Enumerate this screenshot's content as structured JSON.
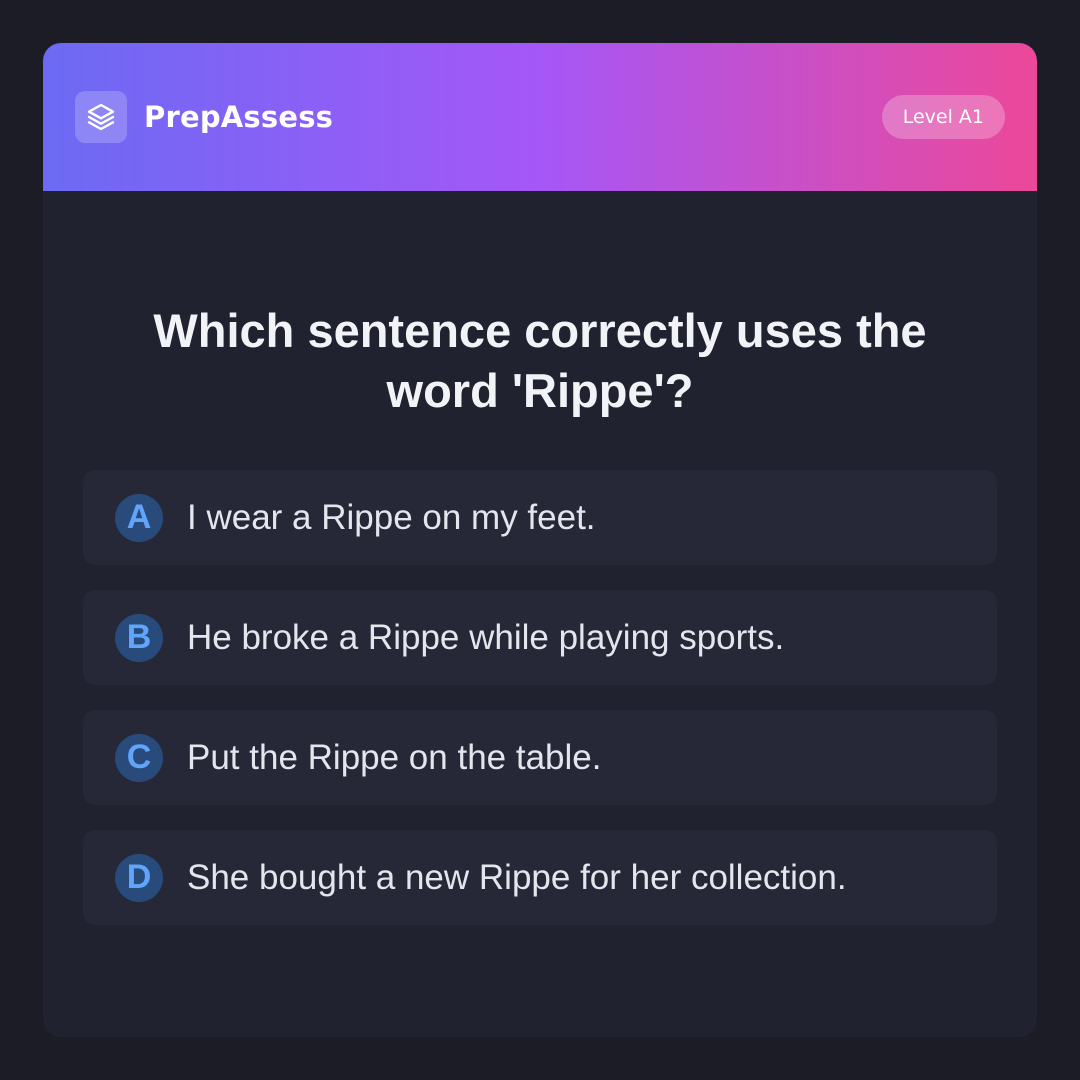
{
  "app": {
    "name": "PrepAssess",
    "logo_icon": "layers-icon",
    "level_badge": "Level A1"
  },
  "colors": {
    "gradient_start": "#6c6af4",
    "gradient_mid": "#a557f7",
    "gradient_end": "#ec4899",
    "card_background": "#20222f",
    "option_background": "#262837",
    "letter_circle": "#294b7c",
    "letter_color": "#60a5fa"
  },
  "question": {
    "text": "Which sentence correctly uses the word 'Rippe'?"
  },
  "options": [
    {
      "letter": "A",
      "text": "I wear a Rippe on my feet."
    },
    {
      "letter": "B",
      "text": "He broke a Rippe while playing sports."
    },
    {
      "letter": "C",
      "text": "Put the Rippe on the table."
    },
    {
      "letter": "D",
      "text": "She bought a new Rippe for her collection."
    }
  ]
}
